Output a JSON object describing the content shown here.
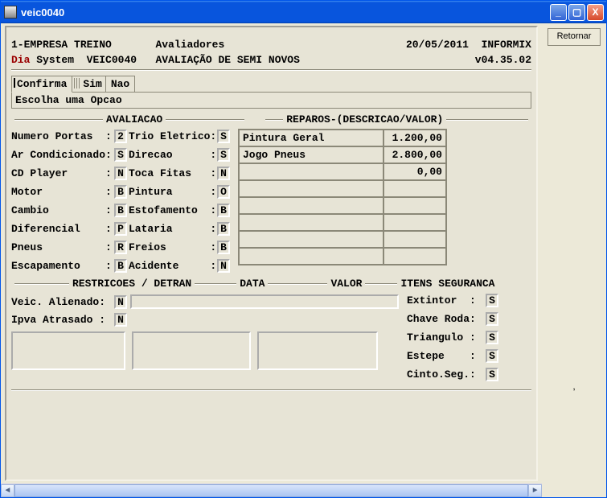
{
  "window": {
    "title": "veic0040"
  },
  "sidebar": {
    "retornar": "Retornar"
  },
  "header": {
    "company": "1-EMPRESA TREINO",
    "page_label": "Avaliadores",
    "date": "20/05/2011",
    "db": "INFORMIX",
    "dia": "Dia",
    "system": "System",
    "program": "VEIC0040",
    "page_title": "AVALIAÇÃO DE SEMI NOVOS",
    "version": "v04.35.02"
  },
  "tabs": {
    "confirma": "Confirma",
    "sim": "Sim",
    "nao": "Nao"
  },
  "prompt": "Escolha uma Opcao",
  "sections": {
    "avaliacao": "AVALIACAO",
    "reparos": "REPAROS-(DESCRICAO/VALOR)",
    "restricoes": "RESTRICOES / DETRAN",
    "data": "DATA",
    "valor": "VALOR",
    "itens_seg": "ITENS SEGURANCA"
  },
  "avaliacao": {
    "left": [
      {
        "label": "Numero Portas  :",
        "val": "2"
      },
      {
        "label": "Ar Condicionado:",
        "val": "S"
      },
      {
        "label": "CD Player      :",
        "val": "N"
      },
      {
        "label": "Motor          :",
        "val": "B"
      },
      {
        "label": "Cambio         :",
        "val": "B"
      },
      {
        "label": "Diferencial    :",
        "val": "P"
      },
      {
        "label": "Pneus          :",
        "val": "R"
      },
      {
        "label": "Escapamento    :",
        "val": "B"
      }
    ],
    "right": [
      {
        "label": "Trio Eletrico:",
        "val": "S"
      },
      {
        "label": "Direcao      :",
        "val": "S"
      },
      {
        "label": "Toca Fitas   :",
        "val": "N"
      },
      {
        "label": "Pintura      :",
        "val": "O"
      },
      {
        "label": "Estofamento  :",
        "val": "B"
      },
      {
        "label": "Lataria      :",
        "val": "B"
      },
      {
        "label": "Freios       :",
        "val": "B"
      },
      {
        "label": "Acidente     :",
        "val": "N"
      }
    ]
  },
  "reparos": [
    {
      "desc": "Pintura Geral",
      "valor": "1.200,00"
    },
    {
      "desc": "Jogo Pneus",
      "valor": "2.800,00"
    },
    {
      "desc": "",
      "valor": "0,00"
    },
    {
      "desc": "",
      "valor": ""
    },
    {
      "desc": "",
      "valor": ""
    },
    {
      "desc": "",
      "valor": ""
    },
    {
      "desc": "",
      "valor": ""
    },
    {
      "desc": "",
      "valor": ""
    }
  ],
  "restricoes": {
    "alienado_label": "Veic. Alienado:",
    "alienado_val": "N",
    "ipva_label": "Ipva Atrasado :",
    "ipva_val": "N"
  },
  "itens": [
    {
      "label": "Extintor  :",
      "val": "S"
    },
    {
      "label": "Chave Roda:",
      "val": "S"
    },
    {
      "label": "Triangulo :",
      "val": "S"
    },
    {
      "label": "Estepe    :",
      "val": "S"
    },
    {
      "label": "Cinto.Seg.:",
      "val": "S"
    }
  ]
}
